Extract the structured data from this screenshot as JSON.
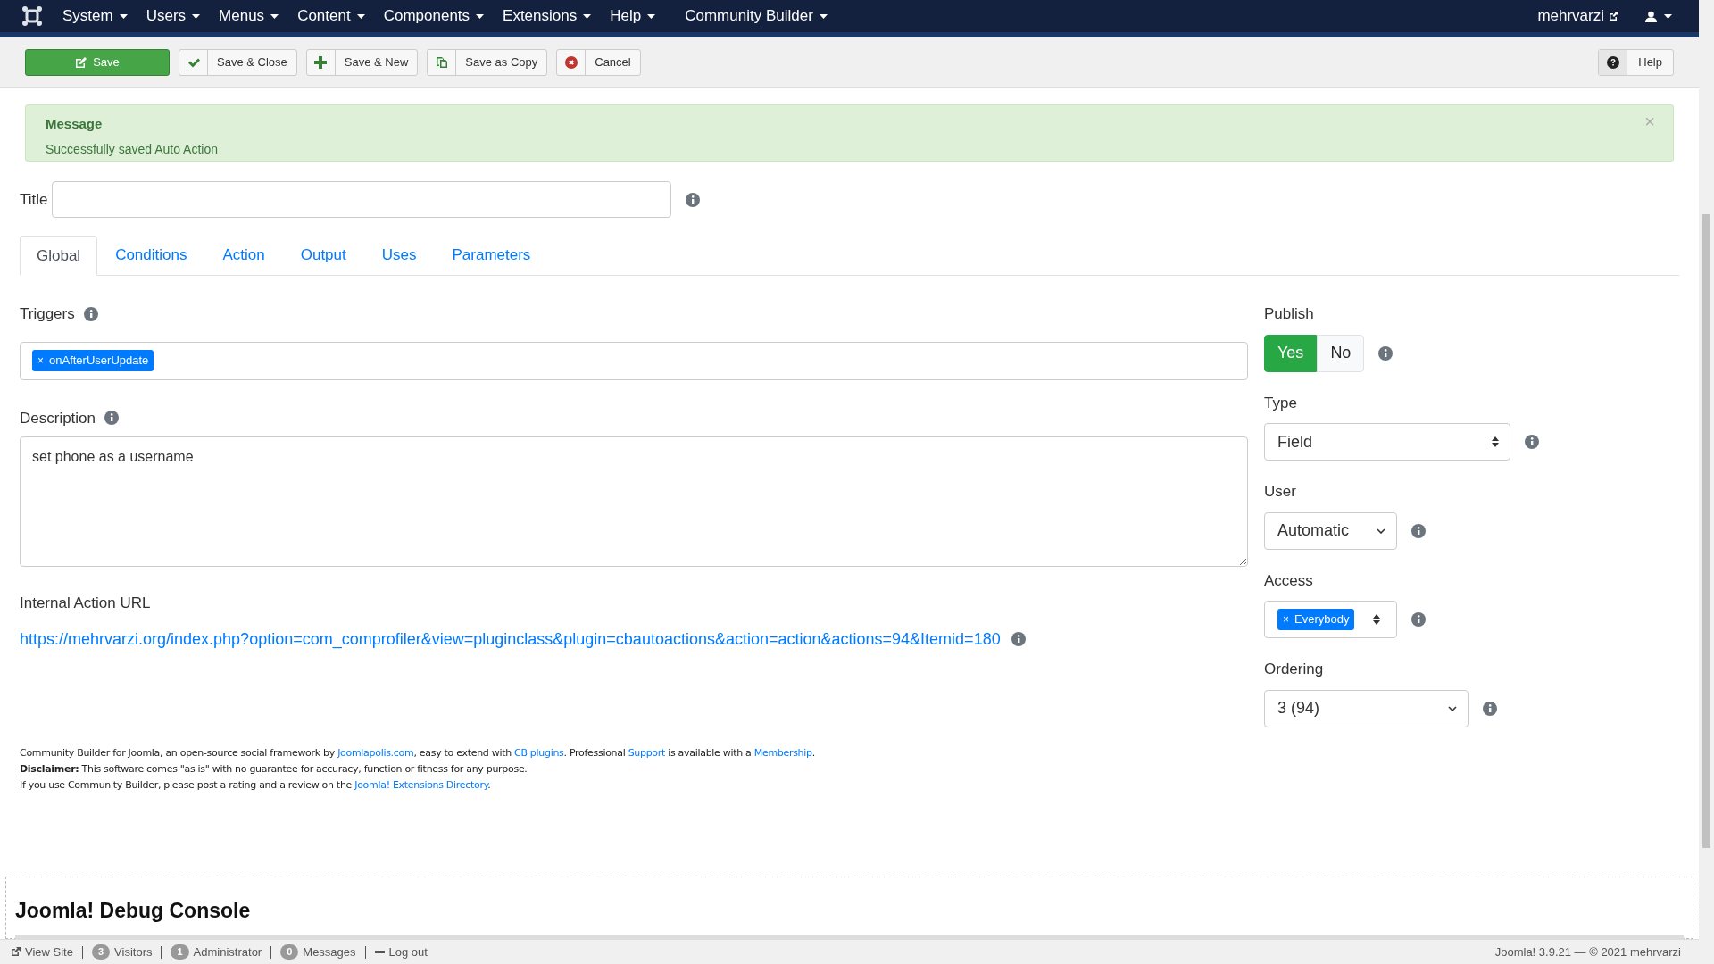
{
  "menu": {
    "items": [
      "System",
      "Users",
      "Menus",
      "Content",
      "Components",
      "Extensions",
      "Help",
      "Community Builder"
    ],
    "user": "mehrvarzi"
  },
  "toolbar": {
    "buttons": [
      {
        "label": "Save",
        "kind": "save"
      },
      {
        "label": "Save & Close",
        "kind": "check"
      },
      {
        "label": "Save & New",
        "kind": "plus"
      },
      {
        "label": "Save as Copy",
        "kind": "copy"
      },
      {
        "label": "Cancel",
        "kind": "cancel"
      }
    ],
    "help": "Help"
  },
  "message": {
    "heading": "Message",
    "text": "Successfully saved Auto Action",
    "close": "×"
  },
  "title": {
    "label": "Title"
  },
  "tabs": [
    {
      "label": "Global",
      "selected": true
    },
    {
      "label": "Conditions",
      "selected": false
    },
    {
      "label": "Action",
      "selected": false
    },
    {
      "label": "Output",
      "selected": false
    },
    {
      "label": "Uses",
      "selected": false
    },
    {
      "label": "Parameters",
      "selected": false
    }
  ],
  "triggers": {
    "label": "Triggers",
    "tags": [
      {
        "remove": "×",
        "label": "onAfterUserUpdate"
      }
    ]
  },
  "description": {
    "label": "Description",
    "value": "set phone as a username"
  },
  "internal_url": {
    "label": "Internal Action URL",
    "link": "https://mehrvarzi.org/index.php?option=com_comprofiler&view=pluginclass&plugin=cbautoactions&action=action&actions=94&Itemid=180"
  },
  "publish": {
    "label": "Publish",
    "options": [
      {
        "label": "Yes",
        "selected": true
      },
      {
        "label": "No",
        "selected": false
      }
    ]
  },
  "type": {
    "label": "Type",
    "value": "Field"
  },
  "user": {
    "label": "User",
    "value": "Automatic"
  },
  "access": {
    "label": "Access",
    "tags": [
      {
        "remove": "×",
        "label": "Everybody"
      }
    ]
  },
  "ordering": {
    "label": "Ordering",
    "value": "3 (94)"
  },
  "footer": [
    [
      {
        "kind": "text",
        "text": "Community Builder for Joomla, an open-source social framework by "
      },
      {
        "kind": "link",
        "text": "Joomlapolis.com"
      },
      {
        "kind": "text",
        "text": ", easy to extend with "
      },
      {
        "kind": "link",
        "text": "CB plugins"
      },
      {
        "kind": "text",
        "text": ". Professional "
      },
      {
        "kind": "link",
        "text": "Support"
      },
      {
        "kind": "text",
        "text": " is available with a "
      },
      {
        "kind": "link",
        "text": "Membership"
      },
      {
        "kind": "text",
        "text": "."
      }
    ],
    [
      {
        "kind": "bold",
        "text": "Disclaimer:"
      },
      {
        "kind": "text",
        "text": " This software comes \"as is\" with no guarantee for accuracy, function or fitness for any purpose."
      }
    ],
    [
      {
        "kind": "text",
        "text": "If you use Community Builder, please post a rating and a review on the "
      },
      {
        "kind": "link",
        "text": "Joomla! Extensions Directory"
      },
      {
        "kind": "text",
        "text": "."
      }
    ]
  ],
  "debug_console": {
    "title": "Joomla! Debug Console"
  },
  "status_bar": {
    "items": [
      {
        "kind": "link",
        "label": "View Site"
      },
      {
        "kind": "count",
        "count": "3",
        "label": "Visitors"
      },
      {
        "kind": "count",
        "count": "1",
        "label": "Administrator"
      },
      {
        "kind": "count",
        "count": "0",
        "label": "Messages"
      },
      {
        "kind": "logout",
        "label": "Log out"
      }
    ],
    "version": "Joomla! 3.9.21 — © 2021 mehrvarzi"
  }
}
